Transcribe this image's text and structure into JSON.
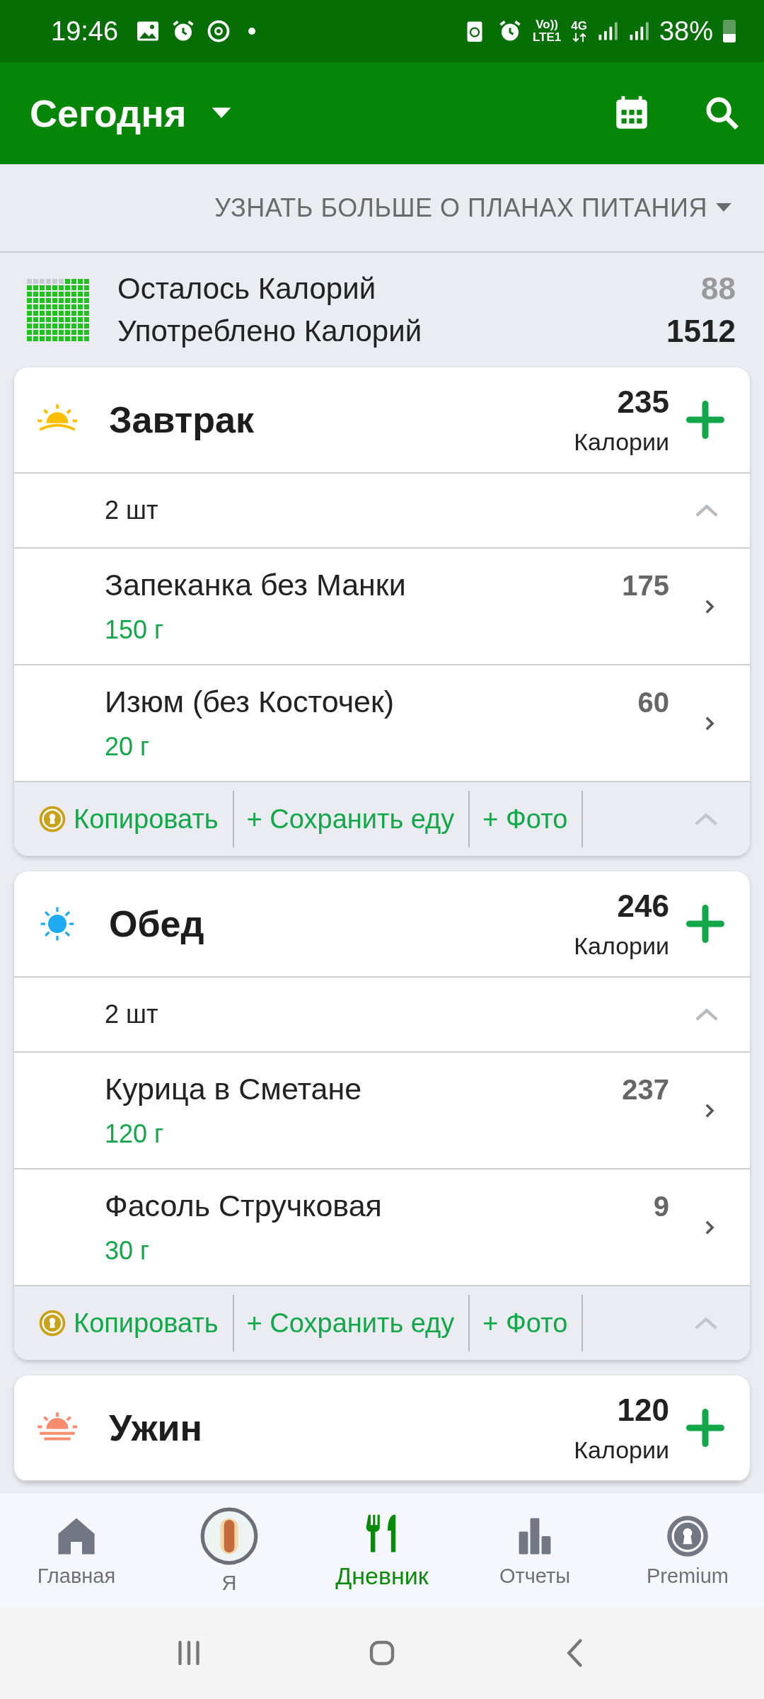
{
  "status_bar": {
    "time": "19:46",
    "volte": "Vo))",
    "lte": "LTE1",
    "network": "4G",
    "battery": "38%"
  },
  "app_bar": {
    "title": "Сегодня"
  },
  "meal_plans_link": "УЗНАТЬ БОЛЬШЕ О ПЛАНАХ ПИТАНИЯ",
  "summary": {
    "rows": [
      {
        "label": "Осталось Калорий",
        "value": "88",
        "kind": "remaining"
      },
      {
        "label": "Употреблено Калорий",
        "value": "1512",
        "kind": "consumed"
      }
    ]
  },
  "meals": [
    {
      "name": "Завтрак",
      "kind": "sunrise",
      "calories": "235",
      "calories_label": "Калории",
      "count": "2 шт",
      "expanded": true,
      "items": [
        {
          "name": "Запеканка без Манки",
          "amount": "150 г",
          "calories": "175"
        },
        {
          "name": "Изюм (без Косточек)",
          "amount": "20 г",
          "calories": "60"
        }
      ],
      "actions": [
        "Копировать",
        "+ Сохранить еду",
        "+ Фото"
      ]
    },
    {
      "name": "Обед",
      "kind": "sun",
      "calories": "246",
      "calories_label": "Калории",
      "count": "2 шт",
      "expanded": true,
      "items": [
        {
          "name": "Курица в Сметане",
          "amount": "120 г",
          "calories": "237"
        },
        {
          "name": "Фасоль Стручковая",
          "amount": "30 г",
          "calories": "9"
        }
      ],
      "actions": [
        "Копировать",
        "+ Сохранить еду",
        "+ Фото"
      ]
    },
    {
      "name": "Ужин",
      "kind": "sunset",
      "calories": "120",
      "calories_label": "Калории"
    }
  ],
  "bottom_nav": [
    {
      "label": "Главная",
      "kind": "home",
      "selected": false
    },
    {
      "label": "Я",
      "kind": "avatar",
      "selected": false
    },
    {
      "label": "Дневник",
      "kind": "diary",
      "selected": true
    },
    {
      "label": "Отчеты",
      "kind": "reports",
      "selected": false
    },
    {
      "label": "Premium",
      "kind": "premium",
      "selected": false
    }
  ]
}
